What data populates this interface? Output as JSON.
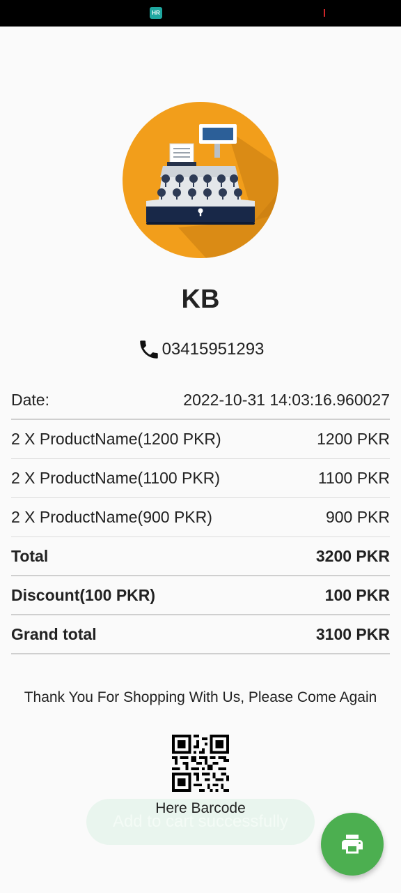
{
  "status_bar": {
    "app_badge": "HR"
  },
  "store": {
    "name": "KB",
    "phone": "03415951293"
  },
  "receipt": {
    "date_label": "Date:",
    "date_value": "2022-10-31 14:03:16.960027",
    "items": [
      {
        "label": "2 X ProductName(1200 PKR)",
        "amount": "1200 PKR"
      },
      {
        "label": "2 X ProductName(1100 PKR)",
        "amount": "1100 PKR"
      },
      {
        "label": "2 X ProductName(900 PKR)",
        "amount": "900 PKR"
      }
    ],
    "total_label": "Total",
    "total_value": "3200 PKR",
    "discount_label": "Discount(100 PKR)",
    "discount_value": "100 PKR",
    "grand_label": "Grand total",
    "grand_value": "3100 PKR"
  },
  "footer": {
    "thanks": "Thank You For Shopping With Us, Please Come Again",
    "barcode_label": "Here Barcode"
  },
  "toast": {
    "message": "Add to cart successfully"
  },
  "fab": {
    "icon": "print-icon"
  },
  "colors": {
    "logo_circle": "#f29e1b",
    "fab": "#4caf50",
    "toast_bg": "#e9f5ee"
  }
}
